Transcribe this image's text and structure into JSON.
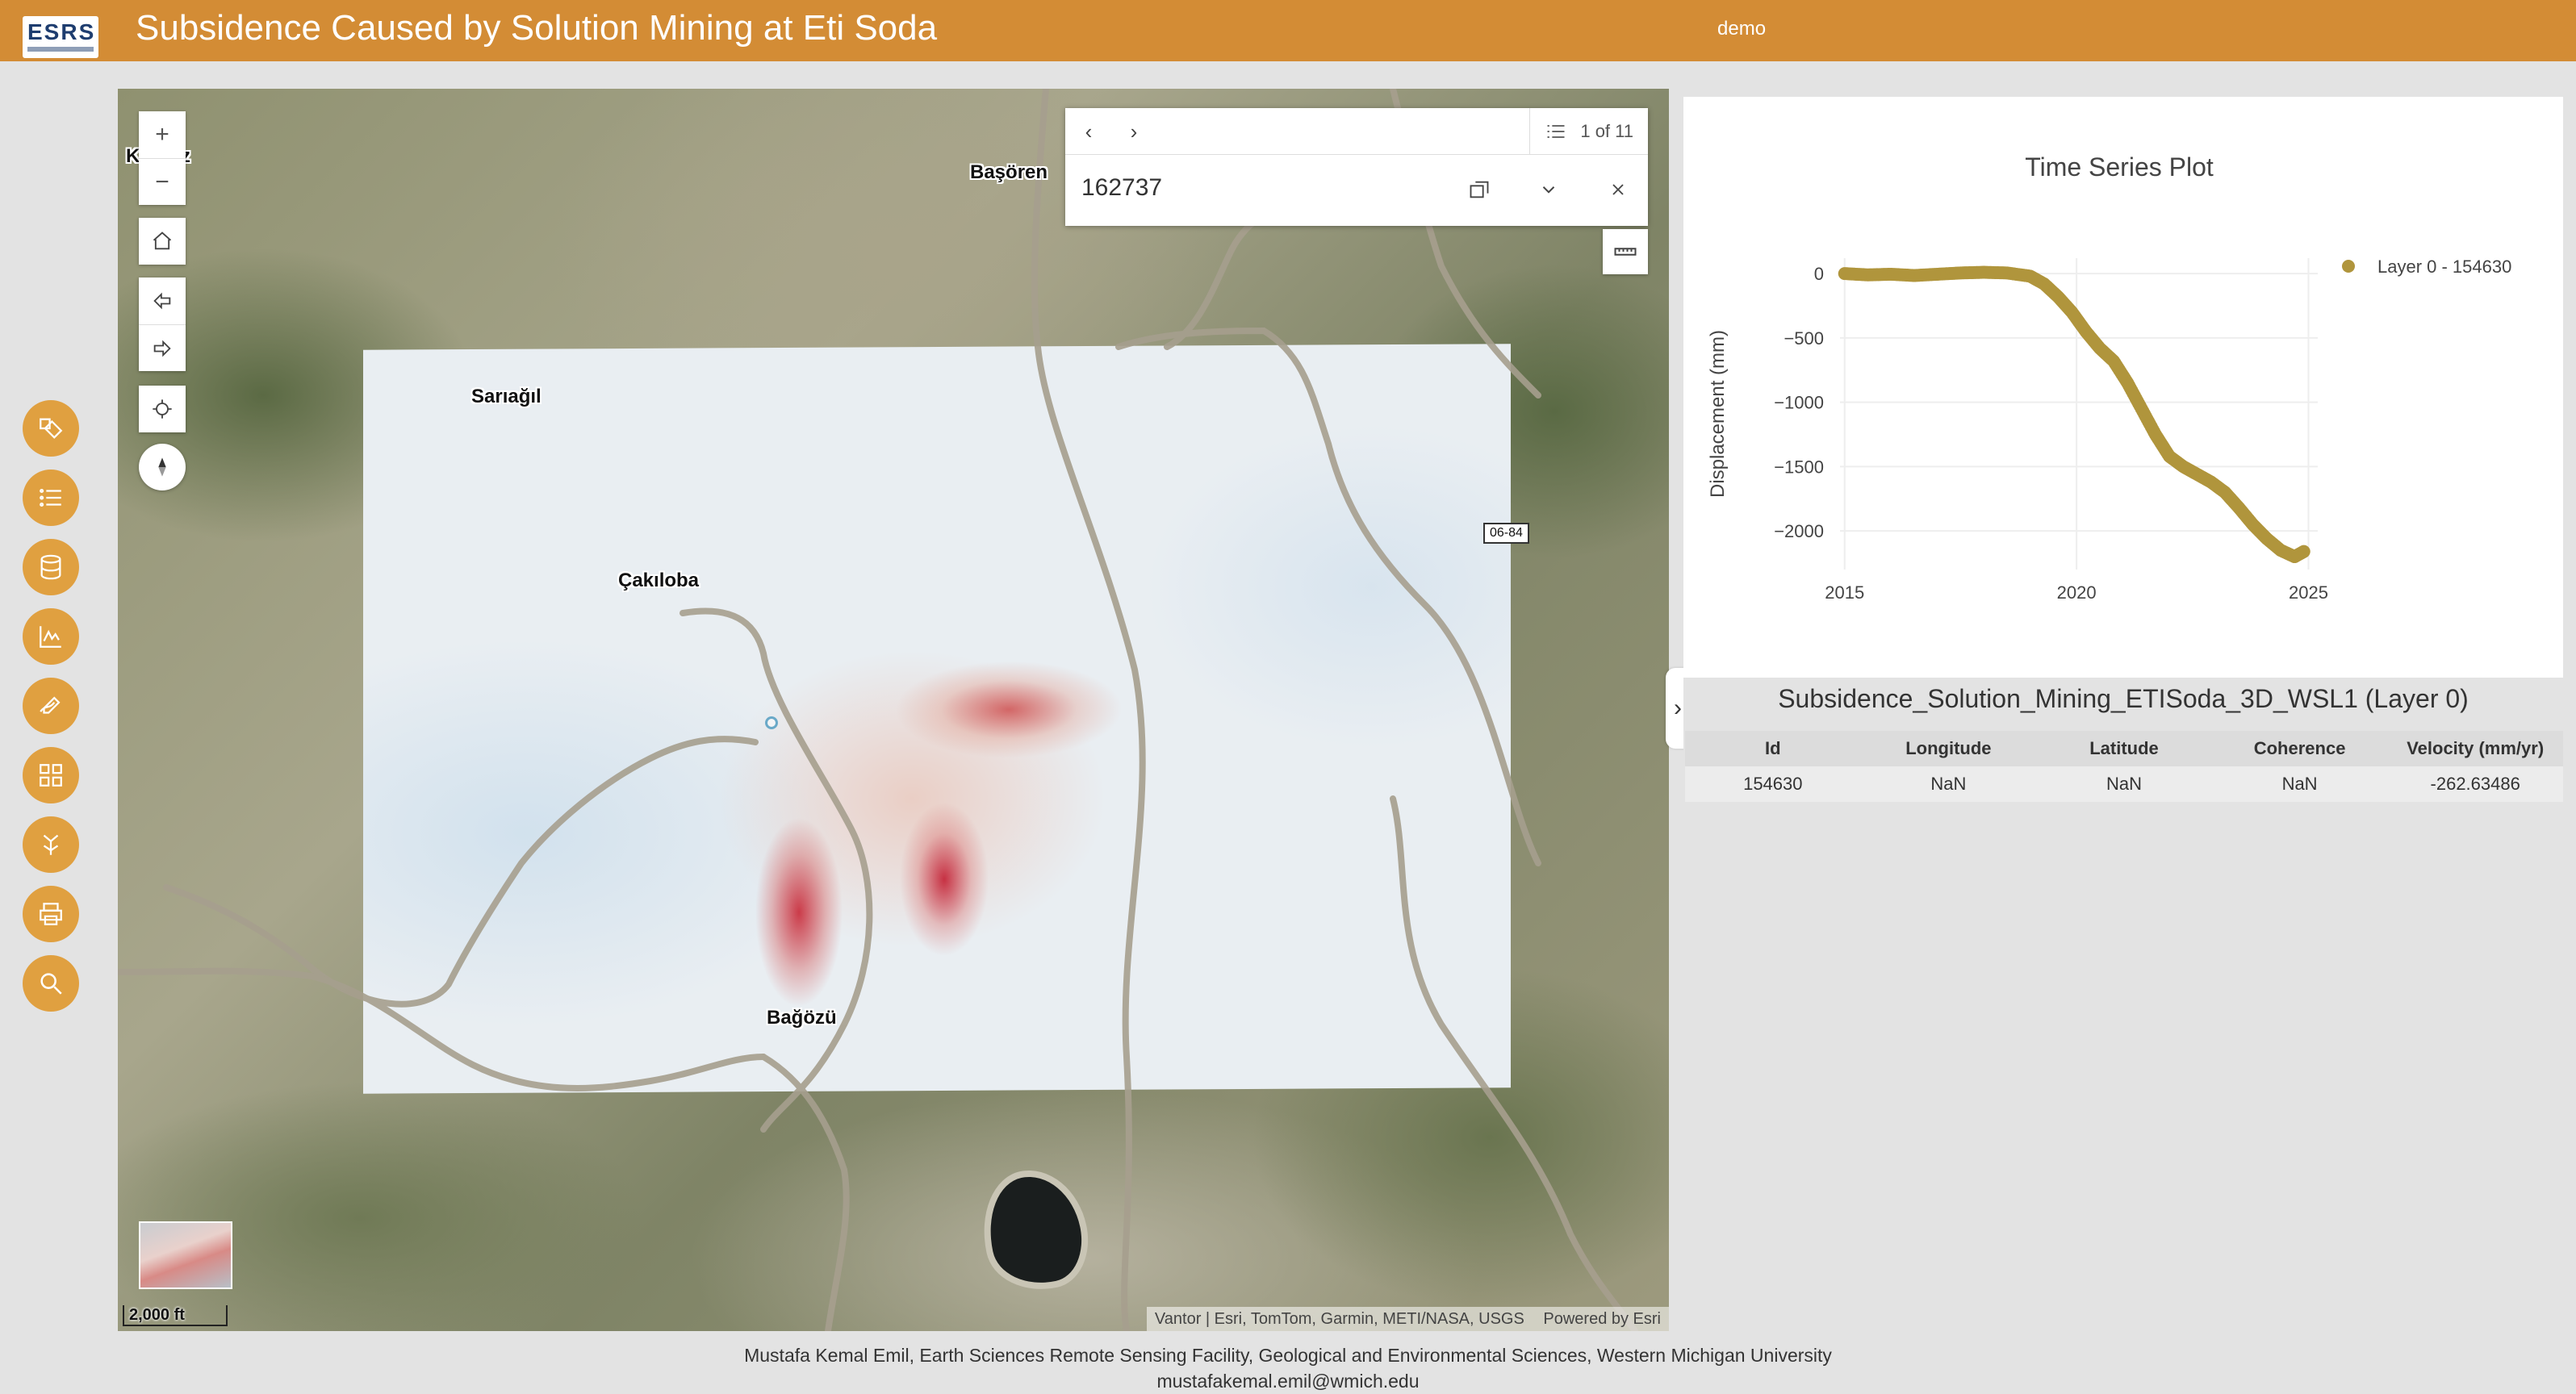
{
  "header": {
    "logo_text": "ESRS",
    "title": "Subsidence Caused by Solution Mining at Eti Soda",
    "subtitle": "demo"
  },
  "side_tools": [
    {
      "name": "legend-icon"
    },
    {
      "name": "layer-list-icon"
    },
    {
      "name": "basemap-icon"
    },
    {
      "name": "chart-icon"
    },
    {
      "name": "sketch-icon"
    },
    {
      "name": "gallery-icon"
    },
    {
      "name": "share-icon"
    },
    {
      "name": "print-icon"
    },
    {
      "name": "search-icon"
    }
  ],
  "map": {
    "places": {
      "top_left": "Karaöz",
      "basoren": "Başören",
      "saraagil": "Sarıağıl",
      "cakiloba": "Çakıloba",
      "bagozu": "Bağözü"
    },
    "shield": "06-84",
    "scale": "2,000 ft",
    "attribution": "Vantor | Esri, TomTom, Garmin, METI/NASA, USGS",
    "powered_by": "Powered by Esri"
  },
  "popup": {
    "count": "1 of 11",
    "title": "162737"
  },
  "chart_data": {
    "type": "scatter",
    "title": "Time Series Plot",
    "ylabel": "Displacement (mm)",
    "xlabel": "",
    "xlim": [
      2014.9,
      2025.2
    ],
    "ylim": [
      -2300,
      120
    ],
    "x_ticks": [
      "2015",
      "2020",
      "2025"
    ],
    "y_ticks": [
      "0",
      "−500",
      "−1000",
      "−1500",
      "−2000"
    ],
    "legend_position": "top-right",
    "series": [
      {
        "name": "Layer 0 - 154630",
        "color": "#b0953c",
        "x": [
          2015.0,
          2015.5,
          2016.0,
          2016.5,
          2017.0,
          2017.5,
          2018.0,
          2018.5,
          2019.0,
          2019.3,
          2019.6,
          2019.9,
          2020.2,
          2020.5,
          2020.8,
          2021.1,
          2021.4,
          2021.7,
          2022.0,
          2022.3,
          2022.6,
          2022.9,
          2023.2,
          2023.5,
          2023.8,
          2024.1,
          2024.4,
          2024.7,
          2024.9
        ],
        "y": [
          0,
          -10,
          -5,
          -15,
          -5,
          5,
          10,
          5,
          -20,
          -80,
          -180,
          -300,
          -450,
          -580,
          -680,
          -850,
          -1050,
          -1250,
          -1420,
          -1500,
          -1560,
          -1620,
          -1700,
          -1820,
          -1950,
          -2060,
          -2150,
          -2200,
          -2160
        ]
      }
    ]
  },
  "table": {
    "title": "Subsidence_Solution_Mining_ETISoda_3D_WSL1 (Layer 0)",
    "columns": [
      "Id",
      "Longitude",
      "Latitude",
      "Coherence",
      "Velocity (mm/yr)"
    ],
    "rows": [
      [
        "154630",
        "NaN",
        "NaN",
        "NaN",
        "-262.63486"
      ]
    ]
  },
  "footer": {
    "line1": "Mustafa Kemal Emil, Earth Sciences Remote Sensing Facility, Geological and Environmental Sciences, Western Michigan University",
    "line2": "mustafakemal.emil@wmich.edu"
  }
}
